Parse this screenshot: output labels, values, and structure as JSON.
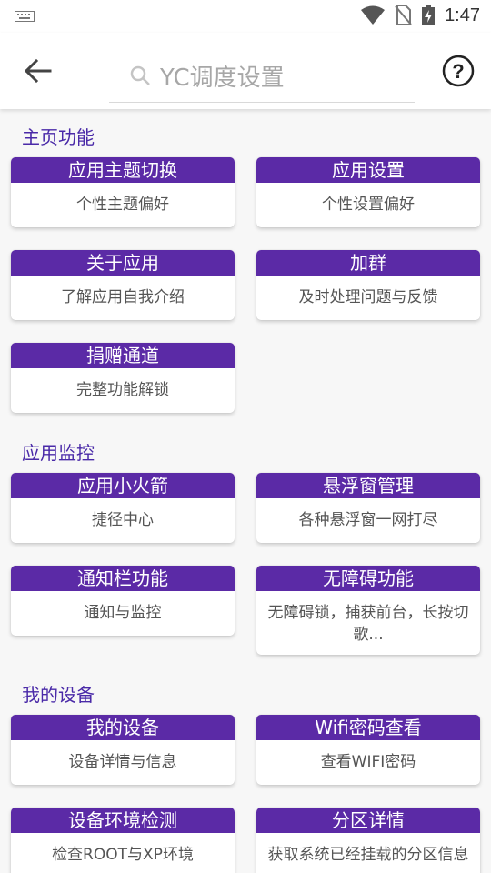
{
  "search": {
    "placeholder": "YC调度设置"
  },
  "status": {
    "time": "1:47"
  },
  "sections": [
    {
      "title": "主页功能",
      "cards": [
        {
          "title": "应用主题切换",
          "desc": "个性主题偏好"
        },
        {
          "title": "应用设置",
          "desc": "个性设置偏好"
        },
        {
          "title": "关于应用",
          "desc": "了解应用自我介绍"
        },
        {
          "title": "加群",
          "desc": "及时处理问题与反馈"
        },
        {
          "title": "捐赠通道",
          "desc": "完整功能解锁"
        }
      ]
    },
    {
      "title": "应用监控",
      "cards": [
        {
          "title": "应用小火箭",
          "desc": "捷径中心"
        },
        {
          "title": "悬浮窗管理",
          "desc": "各种悬浮窗一网打尽"
        },
        {
          "title": "通知栏功能",
          "desc": "通知与监控"
        },
        {
          "title": "无障碍功能",
          "desc": "无障碍锁，捕获前台，长按切歌..."
        }
      ]
    },
    {
      "title": "我的设备",
      "cards": [
        {
          "title": "我的设备",
          "desc": "设备详情与信息"
        },
        {
          "title": "Wifi密码查看",
          "desc": "查看WIFI密码"
        },
        {
          "title": "设备环境检测",
          "desc": "检查ROOT与XP环境"
        },
        {
          "title": "分区详情",
          "desc": "获取系统已经挂载的分区信息"
        }
      ]
    }
  ]
}
